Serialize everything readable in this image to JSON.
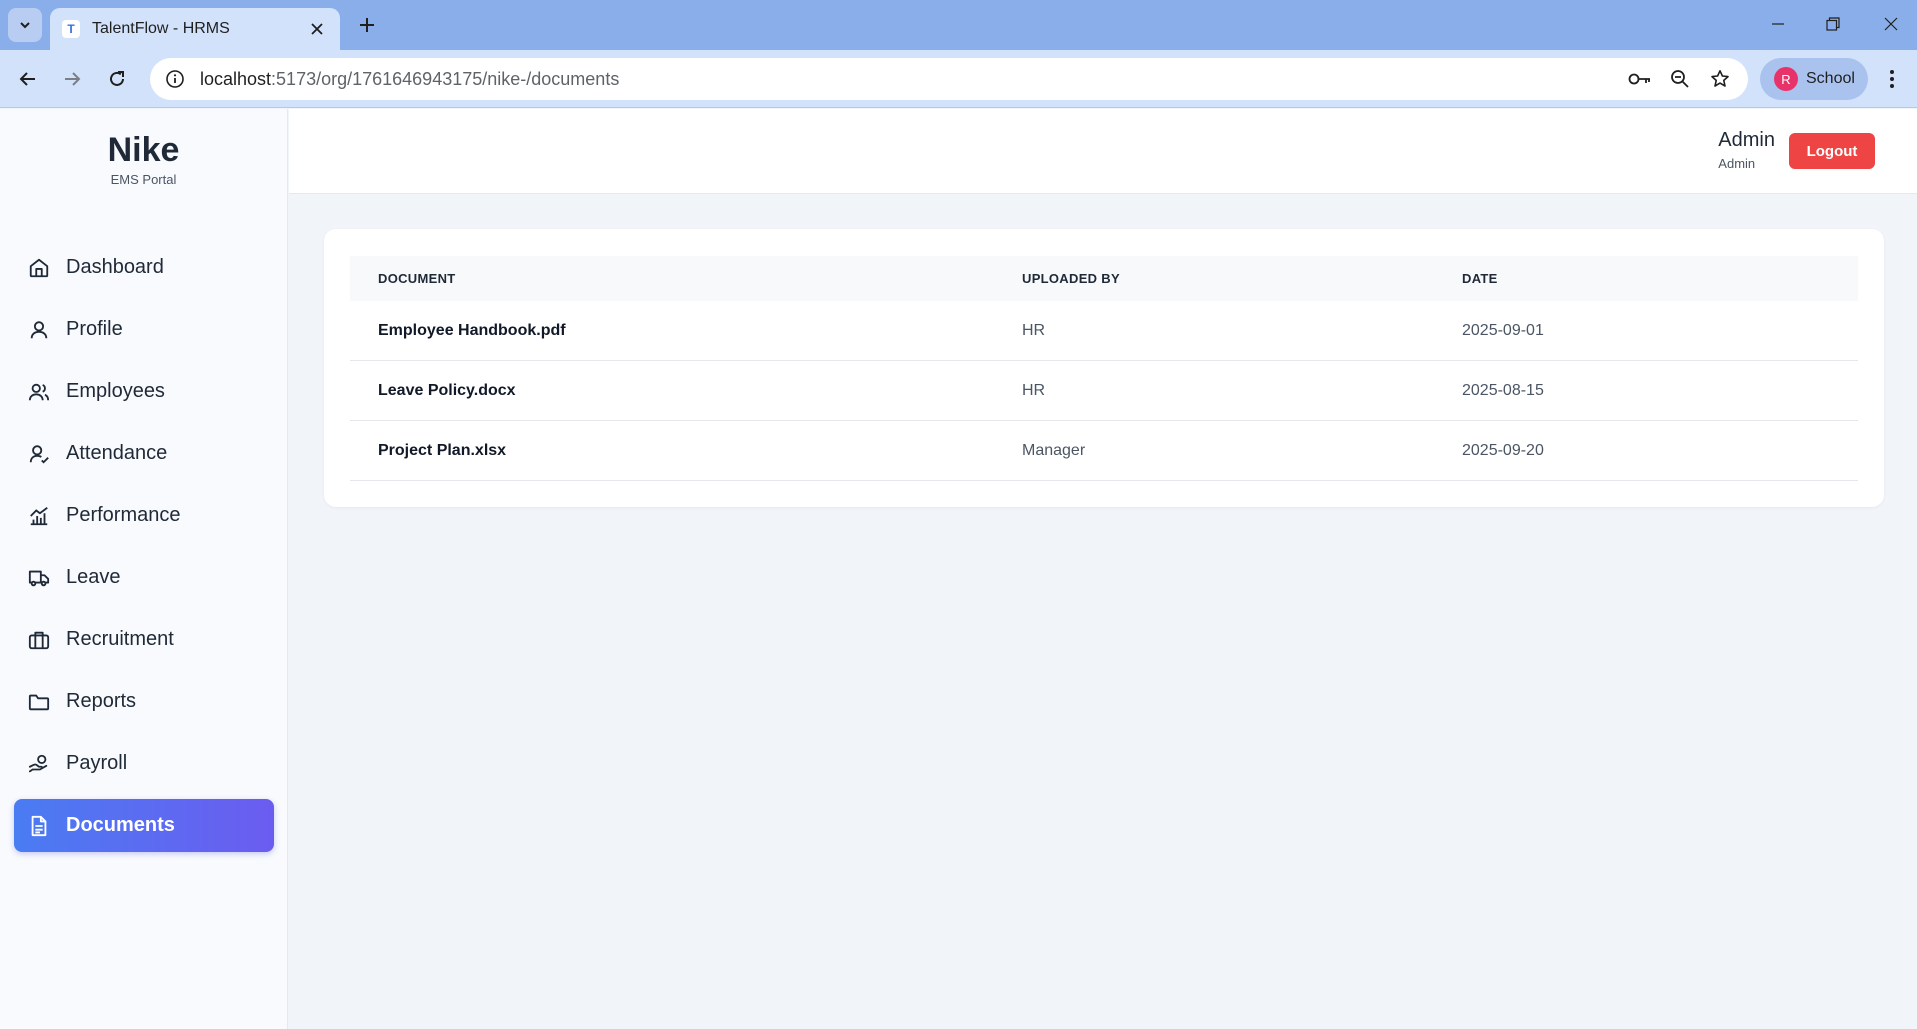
{
  "browser": {
    "tab_title": "TalentFlow - HRMS",
    "tab_favicon_letter": "T",
    "url_host": "localhost",
    "url_path": ":5173/org/1761646943175/nike-/documents",
    "profile_initial": "R",
    "profile_label": "School"
  },
  "sidebar": {
    "brand_name": "Nike",
    "brand_sub": "EMS Portal",
    "items": [
      {
        "label": "Dashboard",
        "icon": "home-icon"
      },
      {
        "label": "Profile",
        "icon": "user-icon"
      },
      {
        "label": "Employees",
        "icon": "users-icon"
      },
      {
        "label": "Attendance",
        "icon": "user-check-icon"
      },
      {
        "label": "Performance",
        "icon": "chart-icon"
      },
      {
        "label": "Leave",
        "icon": "truck-icon"
      },
      {
        "label": "Recruitment",
        "icon": "briefcase-icon"
      },
      {
        "label": "Reports",
        "icon": "folder-icon"
      },
      {
        "label": "Payroll",
        "icon": "hand-coins-icon"
      },
      {
        "label": "Documents",
        "icon": "document-icon",
        "active": true
      }
    ]
  },
  "header": {
    "user_name": "Admin",
    "user_role": "Admin",
    "logout_label": "Logout"
  },
  "documents": {
    "columns": [
      "DOCUMENT",
      "UPLOADED BY",
      "DATE"
    ],
    "rows": [
      {
        "name": "Employee Handbook.pdf",
        "uploaded_by": "HR",
        "date": "2025-09-01"
      },
      {
        "name": "Leave Policy.docx",
        "uploaded_by": "HR",
        "date": "2025-08-15"
      },
      {
        "name": "Project Plan.xlsx",
        "uploaded_by": "Manager",
        "date": "2025-09-20"
      }
    ]
  },
  "colors": {
    "accent": "#4a7cf2",
    "logout": "#ef4444",
    "browser_frame": "#8aaee9"
  }
}
